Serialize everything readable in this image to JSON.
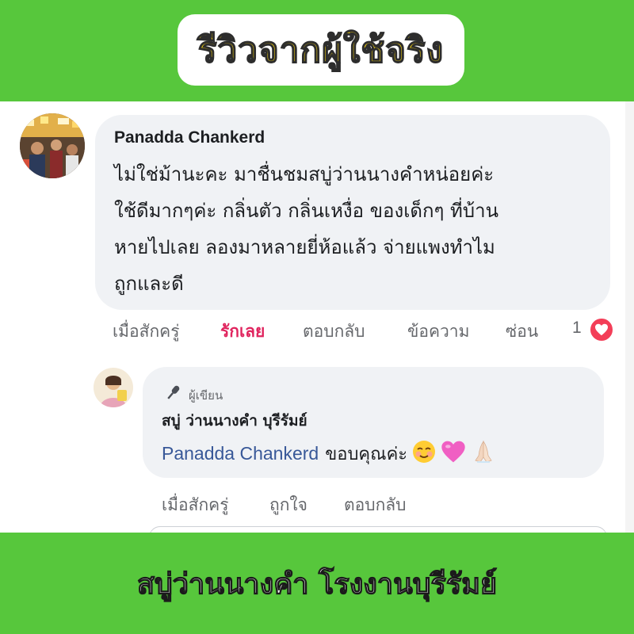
{
  "header": {
    "title": "รีวิวจากผู้ใช้จริง"
  },
  "comment": {
    "author": "Panadda Chankerd",
    "lines": [
      "ไม่ใช่ม้านะคะ  มาชื่นชมสบู่ว่านนางคำหน่อยค่ะ",
      "ใช้ดีมากๆค่ะ  กลิ่นตัว กลิ่นเหงื่อ  ของเด็กๆ ที่บ้าน",
      "หายไปเลย  ลองมาหลายยี่ห้อแล้ว  จ่ายแพงทำไม",
      "ถูกและดี"
    ],
    "actions": {
      "time": "เมื่อสักครู่",
      "love": "รักเลย",
      "reply": "ตอบกลับ",
      "message": "ข้อความ",
      "hide": "ซ่อน"
    },
    "reaction_count": "1",
    "reaction_icon": "heart-icon",
    "colors": {
      "love": "#e0245e",
      "heart": "#f33e58"
    }
  },
  "reply": {
    "badge_label": "ผู้เขียน",
    "badge_icon": "microphone-icon",
    "page_name": "สบู่  ว่านนางคำ  บุรีรัมย์",
    "mention": "Panadda Chankerd",
    "text": "ขอบคุณค่ะ",
    "emojis": [
      "smiling-face-icon",
      "pink-heart-icon",
      "folded-hands-icon"
    ],
    "actions": {
      "time": "เมื่อสักครู่",
      "like": "ถูกใจ",
      "reply": "ตอบกลับ"
    },
    "colors": {
      "mention": "#385898"
    }
  },
  "footer": {
    "text": "สบู่ว่านนางคำ โรงงานบุรีรัมย์"
  },
  "colors": {
    "band": "#57c73c",
    "title_fill": "#f3d10f",
    "bubble": "#f0f2f5"
  }
}
